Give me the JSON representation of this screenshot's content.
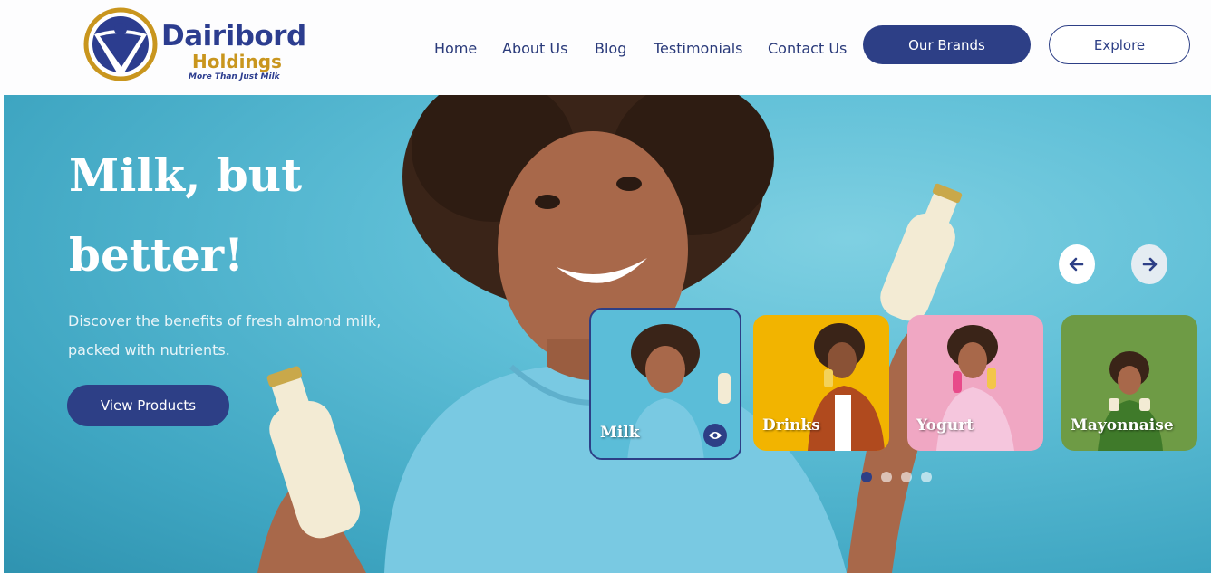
{
  "logo": {
    "title": "Dairibord",
    "subtitle": "Holdings",
    "tagline": "More Than Just Milk"
  },
  "nav": {
    "items": [
      "Home",
      "About Us",
      "Blog",
      "Testimonials",
      "Contact Us"
    ]
  },
  "header_buttons": {
    "brands": "Our Brands",
    "explore": "Explore"
  },
  "hero": {
    "title_line1": "Milk, but",
    "title_line2": "better!",
    "subtitle_line1": "Discover the benefits of fresh almond milk,",
    "subtitle_line2": "packed with nutrients.",
    "cta": "View Products"
  },
  "carousel": {
    "cards": [
      {
        "label": "Milk",
        "bg": "#5bbdd8",
        "active": true
      },
      {
        "label": "Drinks",
        "bg": "#f2b400",
        "active": false
      },
      {
        "label": "Yogurt",
        "bg": "#f0a7c3",
        "active": false
      },
      {
        "label": "Mayonnaise",
        "bg": "#6e9b45",
        "active": false
      }
    ],
    "prev_icon": "arrow-left-icon",
    "next_icon": "arrow-right-icon",
    "active_dot": 0,
    "dot_count": 4
  },
  "colors": {
    "brand_navy": "#2d3f86",
    "brand_gold": "#c9961e",
    "hero_teal": "#5fbfd7"
  }
}
